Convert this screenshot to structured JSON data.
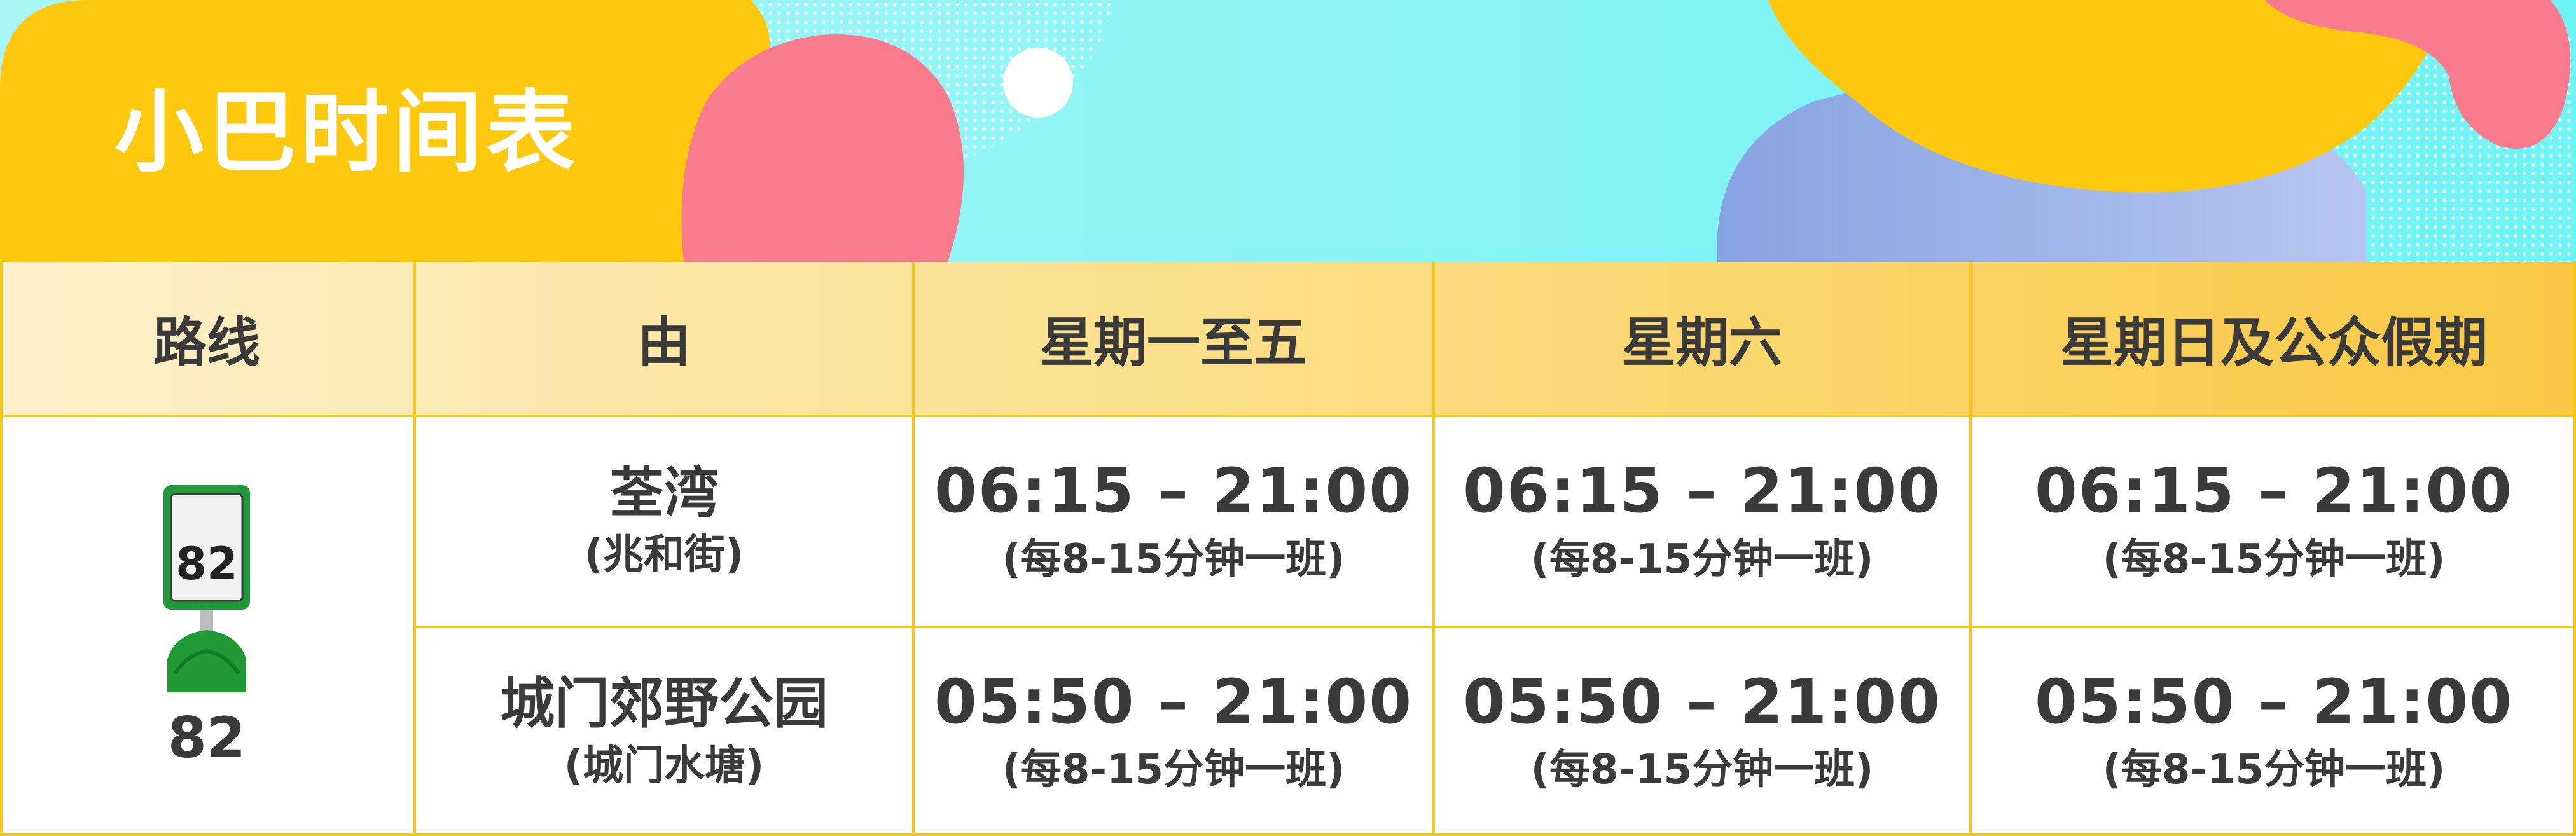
{
  "title": "小巴时间表",
  "headers": [
    "路线",
    "由",
    "星期一至五",
    "星期六",
    "星期日及公众假期"
  ],
  "route": {
    "sign_number": "82",
    "number": "82"
  },
  "rows": [
    {
      "from_main": "荃湾",
      "from_sub": "(兆和街)",
      "weekday_time": "06:15 – 21:00",
      "weekday_freq": "(每8-15分钟一班)",
      "saturday_time": "06:15 – 21:00",
      "saturday_freq": "(每8-15分钟一班)",
      "holiday_time": "06:15 – 21:00",
      "holiday_freq": "(每8-15分钟一班)"
    },
    {
      "from_main": "城门郊野公园",
      "from_sub": "(城门水塘)",
      "weekday_time": "05:50 – 21:00",
      "weekday_freq": "(每8-15分钟一班)",
      "saturday_time": "05:50 – 21:00",
      "saturday_freq": "(每8-15分钟一班)",
      "holiday_time": "05:50 – 21:00",
      "holiday_freq": "(每8-15分钟一班)"
    }
  ],
  "colors": {
    "banner_yellow": "#fdc80d",
    "banner_pink": "#fb7b8e",
    "banner_cyan": "#7ff6f7",
    "banner_periwinkle": "#8fa8e3",
    "header_gradient_start": "#fdf0cc",
    "header_gradient_end": "#fac844",
    "grid_line": "#f5c518",
    "text": "#3a3a3a",
    "sign_green": "#1e9a37"
  },
  "icons": [
    "route-sign-icon"
  ]
}
